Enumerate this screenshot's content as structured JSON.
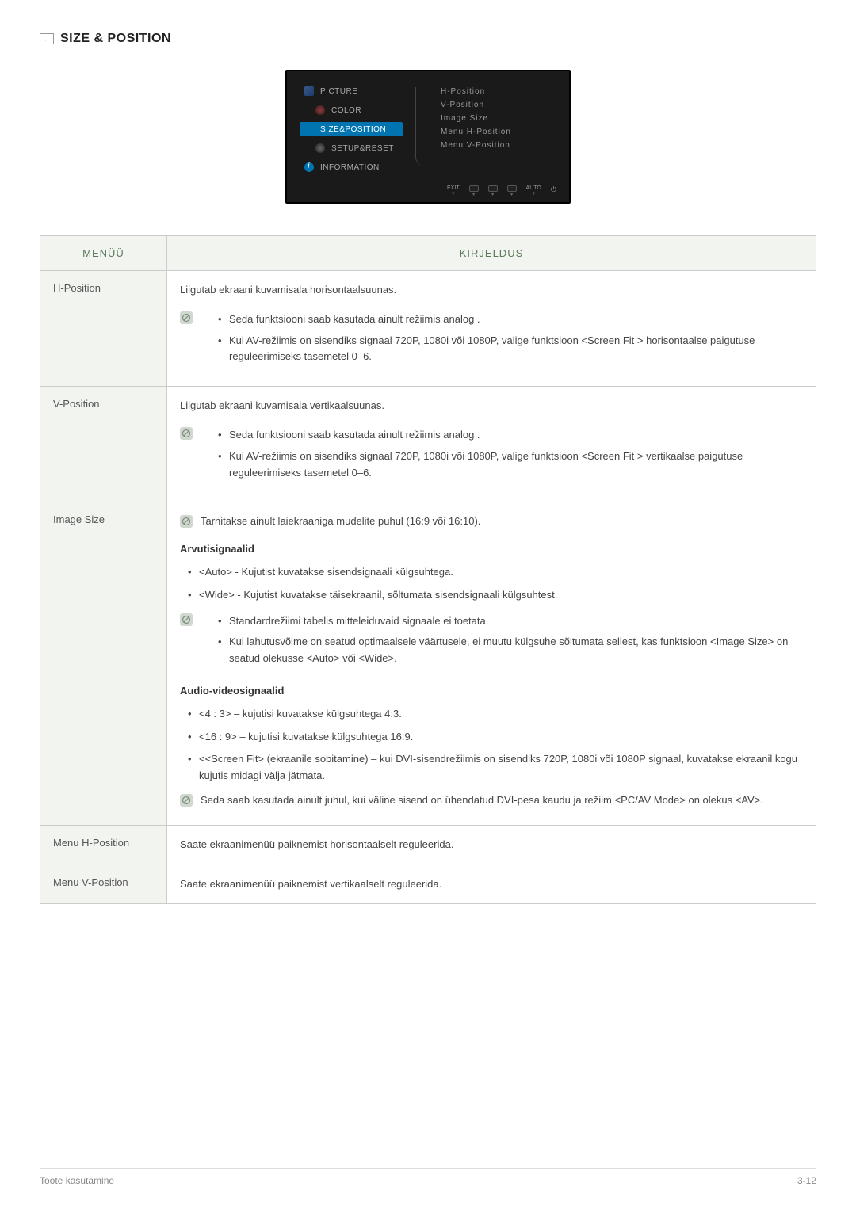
{
  "section": {
    "title": "SIZE & POSITION"
  },
  "osd": {
    "menu": {
      "picture": "PICTURE",
      "color": "COLOR",
      "size": "SIZE&POSITION",
      "setup": "SETUP&RESET",
      "info": "INFORMATION"
    },
    "options": {
      "hpos": "H-Position",
      "vpos": "V-Position",
      "imgsize": "Image Size",
      "menuh": "Menu H-Position",
      "menuv": "Menu V-Position"
    },
    "buttons": {
      "exit": "EXIT",
      "auto": "AUTO"
    }
  },
  "table": {
    "headers": {
      "menu": "MENÜÜ",
      "desc": "KIRJELDUS"
    },
    "rows": {
      "hpos": {
        "label": "H-Position",
        "intro": "Liigutab ekraani kuvamisala horisontaalsuunas.",
        "note1": "Seda funktsiooni saab kasutada ainult režiimis analog .",
        "note2": "Kui AV-režiimis on sisendiks signaal 720P, 1080i või 1080P, valige funktsioon <Screen Fit > horisontaalse paigutuse reguleerimiseks tasemetel 0–6."
      },
      "vpos": {
        "label": "V-Position",
        "intro": "Liigutab ekraani kuvamisala vertikaalsuunas.",
        "note1": "Seda funktsiooni saab kasutada ainult režiimis analog .",
        "note2": "Kui AV-režiimis on sisendiks signaal 720P, 1080i või 1080P, valige funktsioon <Screen Fit > vertikaalse paigutuse reguleerimiseks tasemetel 0–6."
      },
      "imgsize": {
        "label": "Image Size",
        "topnote": "Tarnitakse ainult laiekraaniga mudelite puhul (16:9 või 16:10).",
        "pc_heading": "Arvutisignaalid",
        "pc_b1": "<Auto> - Kujutist kuvatakse sisendsignaali külgsuhtega.",
        "pc_b2": "<Wide> - Kujutist kuvatakse täisekraanil, sõltumata sisendsignaali külgsuhtest.",
        "pc_note1": "Standardrežiimi tabelis mitteleiduvaid signaale ei toetata.",
        "pc_note2": "Kui lahutusvõime on seatud optimaalsele väärtusele, ei muutu külgsuhe sõltumata sellest, kas funktsioon <Image Size> on seatud olekusse <Auto> või <Wide>.",
        "av_heading": "Audio-videosignaalid",
        "av_b1": "<4 : 3> – kujutisi kuvatakse külgsuhtega 4:3.",
        "av_b2": "<16 : 9> – kujutisi kuvatakse külgsuhtega 16:9.",
        "av_b3": "<<Screen Fit> (ekraanile sobitamine) – kui DVI-sisendrežiimis on sisendiks 720P, 1080i või 1080P signaal, kuvatakse ekraanil kogu kujutis midagi välja jätmata.",
        "av_note": "Seda saab kasutada ainult juhul, kui väline sisend on ühendatud DVI-pesa kaudu ja režiim <PC/AV Mode> on olekus <AV>."
      },
      "menuh": {
        "label": "Menu H-Position",
        "desc": "Saate ekraanimenüü paiknemist horisontaalselt reguleerida."
      },
      "menuv": {
        "label": "Menu V-Position",
        "desc": "Saate ekraanimenüü paiknemist vertikaalselt reguleerida."
      }
    }
  },
  "footer": {
    "left": "Toote kasutamine",
    "right": "3-12"
  }
}
